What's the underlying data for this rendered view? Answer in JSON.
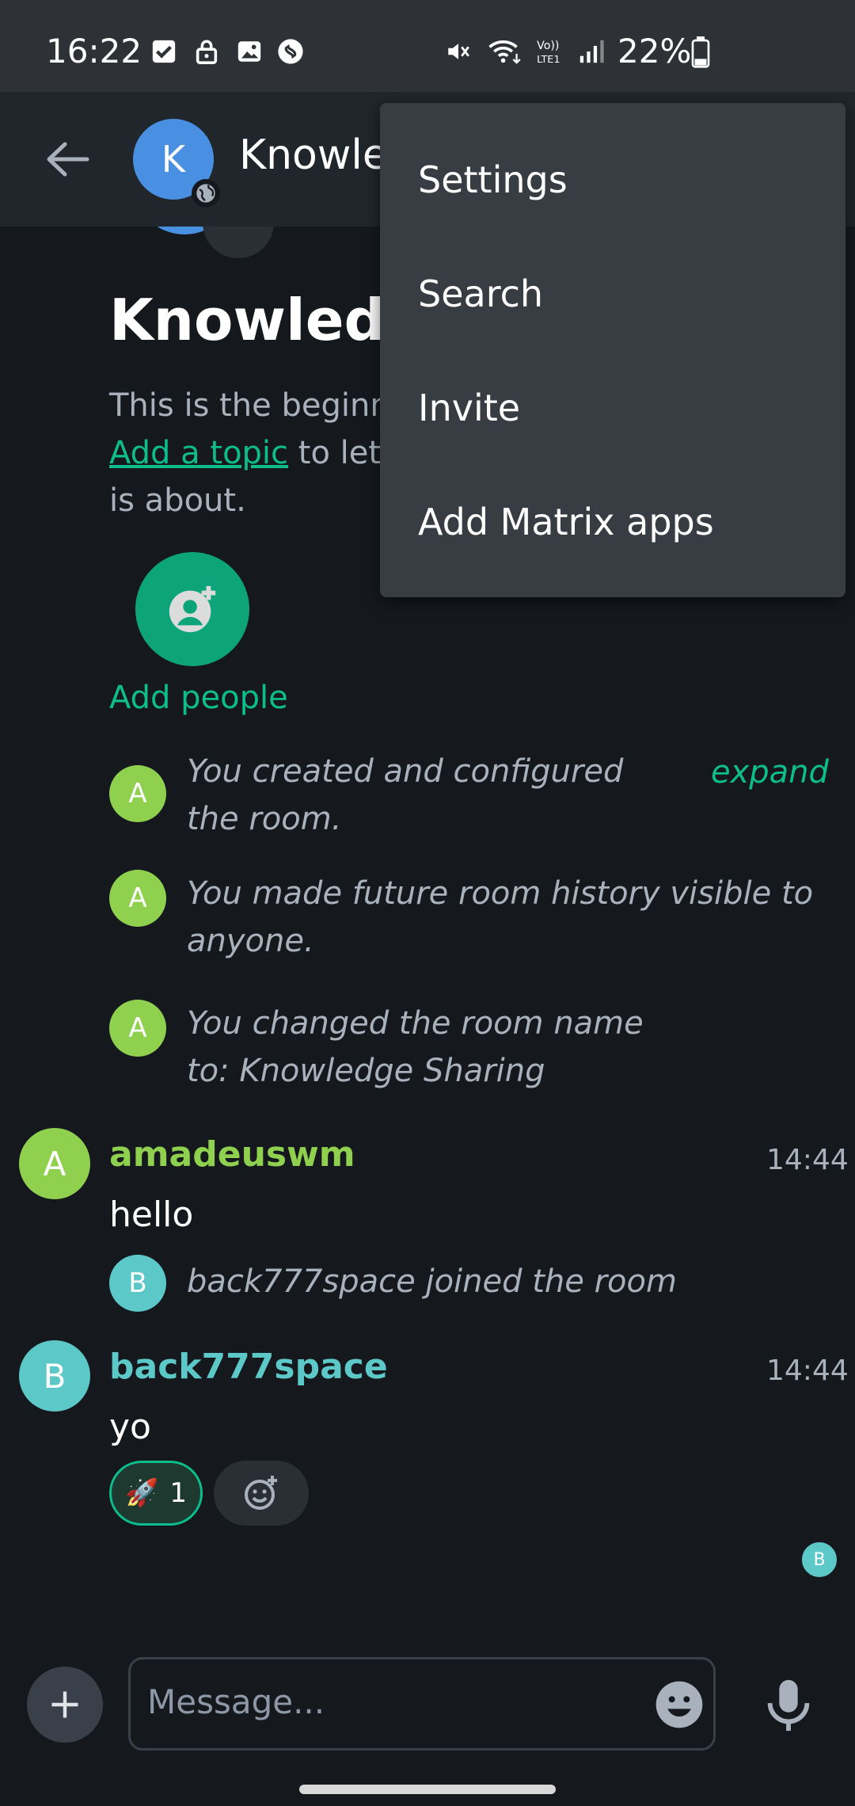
{
  "status_bar": {
    "time": "16:22",
    "battery": "22%",
    "icons_left": [
      "checkbox-icon",
      "lock-icon",
      "image-icon",
      "shazam-icon"
    ],
    "icons_right": [
      "mute-icon",
      "wifi-icon",
      "volte-icon",
      "signal-icon",
      "battery-icon"
    ]
  },
  "header": {
    "avatar_letter": "K",
    "room_name_visible": "Knowle"
  },
  "room_intro": {
    "title_visible": "Knowledge",
    "line1": "This is the beginni",
    "link": "Add a topic",
    "line2_rest": " to let p",
    "line3": "is about.",
    "add_people_label": "Add people"
  },
  "events": [
    {
      "avatar": "A",
      "text": "You created and configured the room.",
      "action": "expand"
    },
    {
      "avatar": "A",
      "text": "You made future room history visible to anyone."
    },
    {
      "avatar": "A",
      "text": "You changed the room name to: Knowledge Sharing"
    }
  ],
  "messages": [
    {
      "avatar": "A",
      "sender": "amadeuswm",
      "time": "14:44",
      "body": "hello",
      "color": "#8fd14f"
    },
    {
      "event_avatar": "B",
      "event_text": "back777space joined the room"
    },
    {
      "avatar": "B",
      "sender": "back777space",
      "time": "14:44",
      "body": "yo",
      "color": "#5cc8c8"
    }
  ],
  "reaction": {
    "emoji": "🚀",
    "count": "1"
  },
  "read_receipt": "B",
  "composer": {
    "placeholder": "Message..."
  },
  "menu": {
    "items": [
      "Settings",
      "Search",
      "Invite",
      "Add Matrix apps"
    ]
  },
  "colors": {
    "accent": "#0dbd8b",
    "avatar_a": "#8fd14f",
    "avatar_b": "#5cc8c8",
    "avatar_room": "#4a90e2"
  }
}
